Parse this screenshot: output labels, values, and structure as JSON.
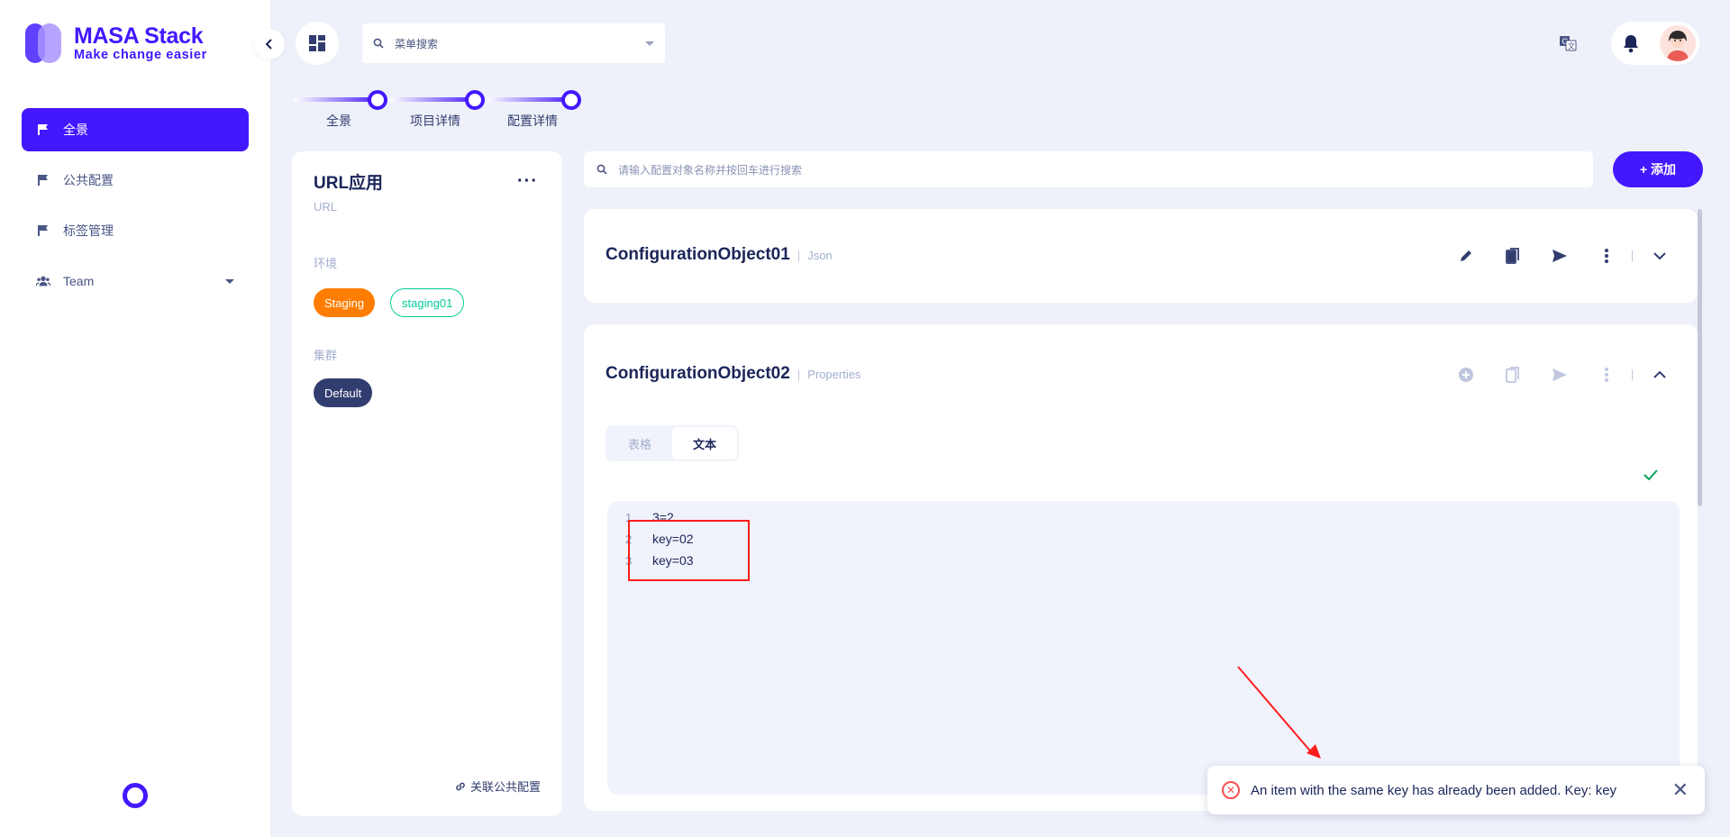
{
  "brand": {
    "title": "MASA Stack",
    "subtitle": "Make change easier"
  },
  "sidebar": {
    "items": [
      {
        "label": "全景",
        "icon": "flag-icon",
        "active": true
      },
      {
        "label": "公共配置",
        "icon": "flag-icon"
      },
      {
        "label": "标签管理",
        "icon": "flag-icon"
      },
      {
        "label": "Team",
        "icon": "team-icon",
        "expandable": true
      }
    ]
  },
  "header": {
    "menu_search_placeholder": "菜单搜索"
  },
  "stepper": {
    "steps": [
      "全景",
      "项目详情",
      "配置详情"
    ]
  },
  "app": {
    "name": "URL应用",
    "more": "···",
    "code": "URL",
    "env_label": "环境",
    "envs": [
      "Staging",
      "staging01"
    ],
    "cluster_label": "集群",
    "cluster": "Default",
    "link_public": "关联公共配置"
  },
  "config_search": {
    "placeholder": "请输入配置对象名称并按回车进行搜索"
  },
  "add_button": "+ 添加",
  "configs": [
    {
      "name": "ConfigurationObject01",
      "separator": "|",
      "format": "Json"
    },
    {
      "name": "ConfigurationObject02",
      "separator": "|",
      "format": "Properties",
      "tabs": [
        "表格",
        "文本"
      ],
      "active_tab": "文本",
      "lines": [
        {
          "n": "1",
          "text": "3=2"
        },
        {
          "n": "2",
          "text": "key=02"
        },
        {
          "n": "3",
          "text": "key=03"
        }
      ]
    }
  ],
  "toast": {
    "message": "An item with the same key has already been added. Key: key",
    "close": "✕"
  },
  "colors": {
    "accent": "#4318ff",
    "staging": "#ff7d00",
    "staging01": "#05cd99",
    "default_chip": "#323d6f",
    "error": "#ff4d4f"
  }
}
